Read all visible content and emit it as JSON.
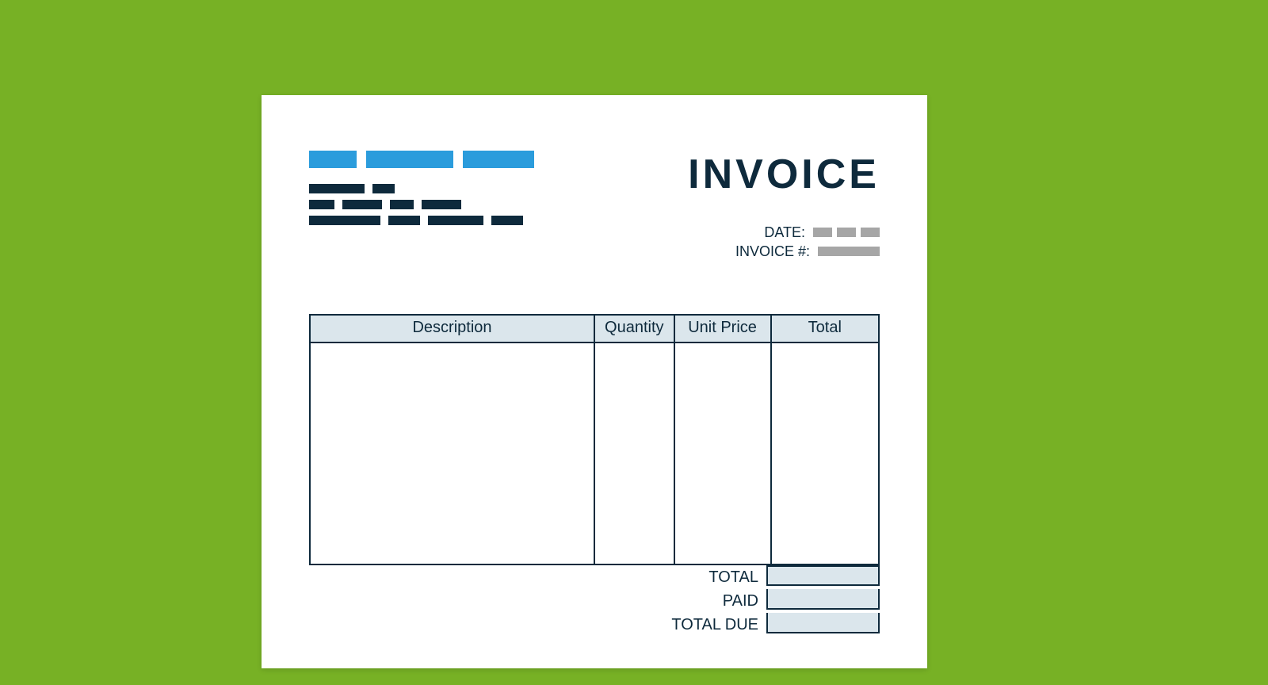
{
  "document": {
    "title": "INVOICE",
    "meta": {
      "date_label": "DATE:",
      "invoice_number_label": "INVOICE #:"
    },
    "table": {
      "headers": {
        "description": "Description",
        "quantity": "Quantity",
        "unit_price": "Unit Price",
        "total": "Total"
      }
    },
    "summary": {
      "total_label": "TOTAL",
      "paid_label": "PAID",
      "total_due_label": "TOTAL DUE"
    }
  },
  "colors": {
    "background": "#77b125",
    "paper": "#ffffff",
    "accent_blue": "#2b9cdc",
    "ink_dark": "#0e2a3c",
    "cell_fill": "#dbe6ec",
    "placeholder_gray": "#a6a6a6"
  }
}
